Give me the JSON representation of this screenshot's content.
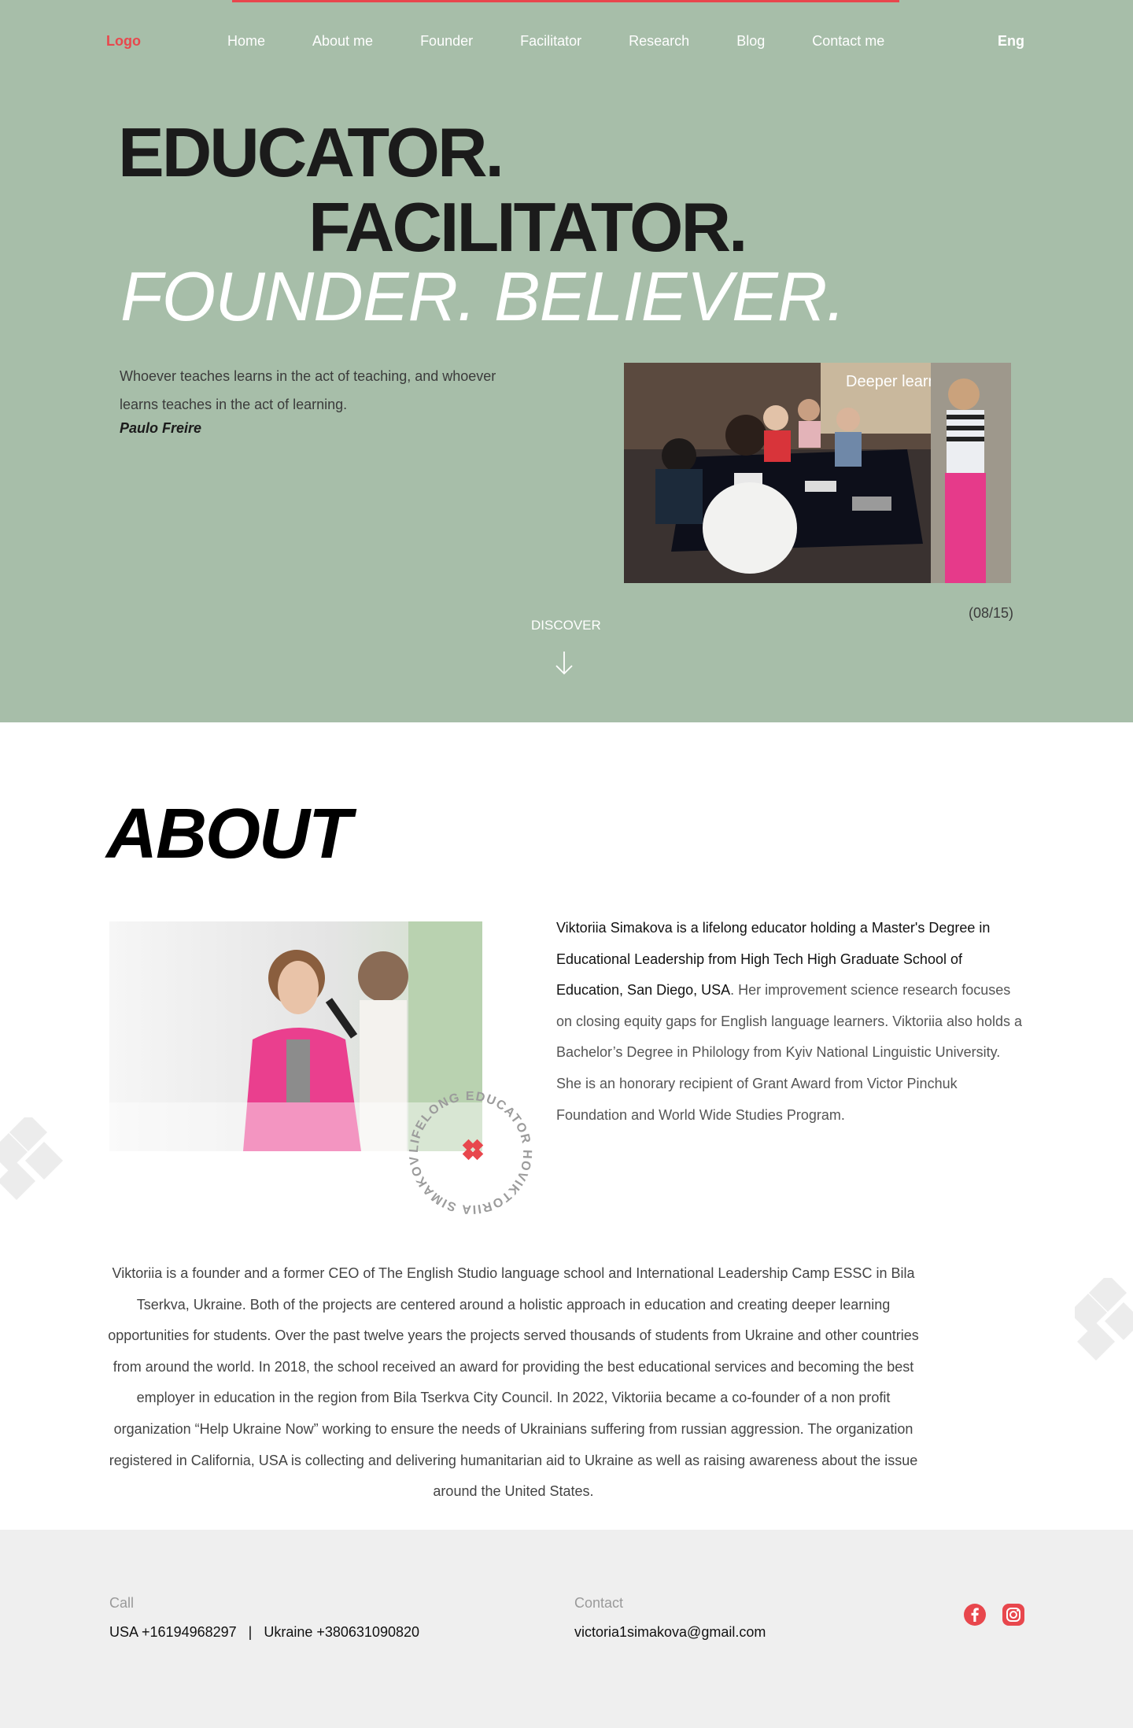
{
  "nav": {
    "logo": "Logo",
    "items": [
      {
        "label": "Home"
      },
      {
        "label": "About me"
      },
      {
        "label": "Founder"
      },
      {
        "label": "Facilitator"
      },
      {
        "label": "Research"
      },
      {
        "label": "Blog"
      },
      {
        "label": "Contact me"
      }
    ],
    "language": "Eng"
  },
  "hero": {
    "line1": "EDUCATOR.",
    "line2": "FACILITATOR.",
    "line3": "FOUNDER. BELIEVER.",
    "quote": "Whoever teaches learns in the act of teaching, and whoever learns teaches in the act of learning.",
    "quote_author": "Paulo Freire",
    "image_sign_text": "Deeper learning",
    "slide_counter": "(08/15)",
    "discover_label": "DISCOVER"
  },
  "about": {
    "title": "ABOUT",
    "badge_text": "LIFELONG EDUCATOR HOVIKTORIIA SIMAKOVA IS • ",
    "intro_bold": "Viktoriia Simakova is a lifelong educator holding a Master's Degree in Educational Leadership from High Tech High Graduate School of Education, San Diego, USA",
    "intro_rest": ". Her improvement science research focuses on closing equity gaps for English language learners. Viktoriia also holds a Bachelor’s Degree in Philology from Kyiv National Linguistic University. She is an honorary recipient of Grant Award from Victor Pinchuk Foundation and World Wide Studies Program.",
    "founder_paragraph": "Viktoriia is a founder and a former CEO of The English Studio language school and International Leadership Camp ESSC in Bila Tserkva, Ukraine. Both of the projects are centered around a holistic approach in education and creating deeper learning opportunities for students. Over the past twelve years the projects served thousands of students from Ukraine and other countries from around the world. In 2018, the school received an award for providing the best educational services  and becoming the best employer in education in the region from Bila Tserkva City Council. In 2022, Viktoriia became a co-founder of a non profit organization “Help Ukraine Now” working to ensure the needs of Ukrainians suffering from russian aggression. The organization registered in California, USA is collecting and delivering humanitarian aid to Ukraine as well as raising awareness about the issue around the United States."
  },
  "footer": {
    "call_label": "Call",
    "call_value": "USA +16194968297   |   Ukraine +380631090820",
    "contact_label": "Contact",
    "contact_value": "victoria1simakova@gmail.com",
    "social": [
      {
        "icon": "facebook-icon"
      },
      {
        "icon": "instagram-icon"
      }
    ]
  },
  "colors": {
    "accent": "#e8474d",
    "hero_bg": "#a7bea9",
    "footer_bg": "#efefef"
  }
}
